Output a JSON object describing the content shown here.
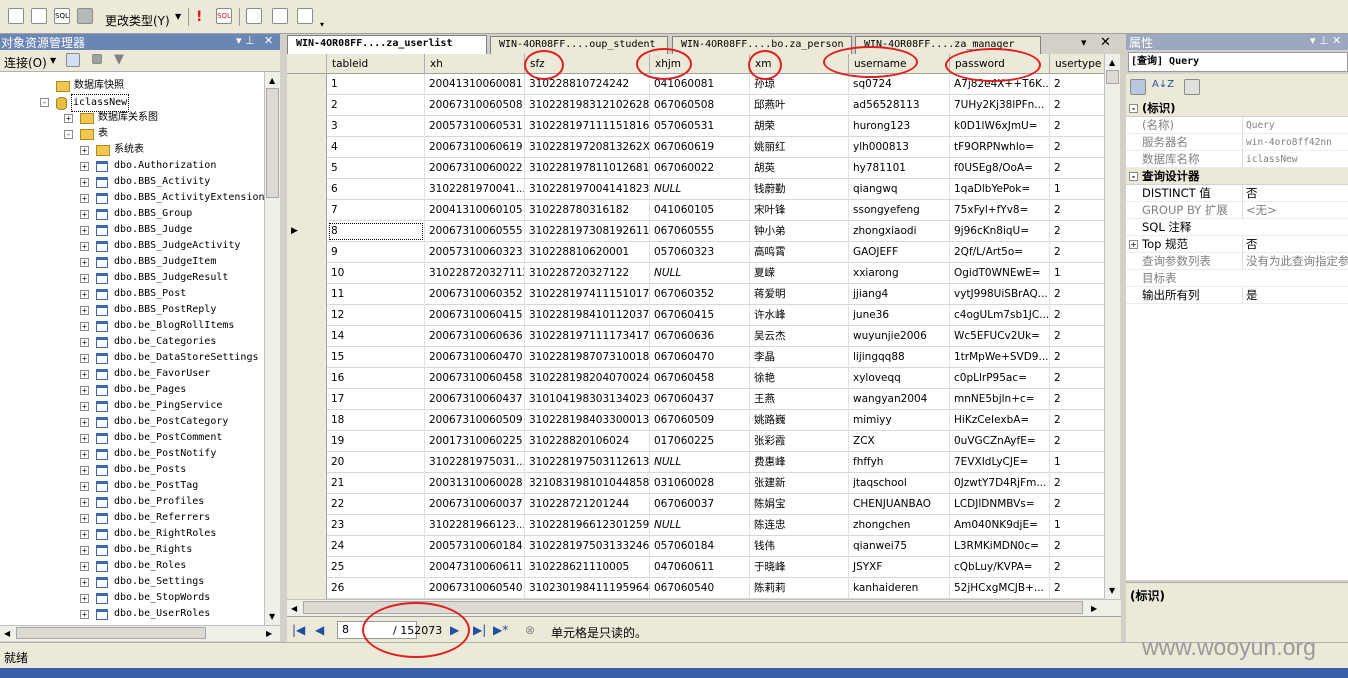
{
  "toolbar": {
    "change_type_label": "更改类型(Y)"
  },
  "object_explorer": {
    "title": "对象资源管理器",
    "connect_label": "连接(O)",
    "tree": [
      {
        "label": "数据库快照",
        "kind": "folder",
        "depth": 0,
        "toggle": ""
      },
      {
        "label": "iclassNew",
        "kind": "db",
        "depth": 0,
        "toggle": "-"
      },
      {
        "label": "数据库关系图",
        "kind": "folder",
        "depth": 1,
        "toggle": "+"
      },
      {
        "label": "表",
        "kind": "folder",
        "depth": 1,
        "toggle": "-"
      },
      {
        "label": "系统表",
        "kind": "folder",
        "depth": 2,
        "toggle": "+"
      },
      {
        "label": "dbo.Authorization",
        "kind": "table",
        "depth": 2,
        "toggle": "+"
      },
      {
        "label": "dbo.BBS_Activity",
        "kind": "table",
        "depth": 2,
        "toggle": "+"
      },
      {
        "label": "dbo.BBS_ActivityExtension",
        "kind": "table",
        "depth": 2,
        "toggle": "+"
      },
      {
        "label": "dbo.BBS_Group",
        "kind": "table",
        "depth": 2,
        "toggle": "+"
      },
      {
        "label": "dbo.BBS_Judge",
        "kind": "table",
        "depth": 2,
        "toggle": "+"
      },
      {
        "label": "dbo.BBS_JudgeActivity",
        "kind": "table",
        "depth": 2,
        "toggle": "+"
      },
      {
        "label": "dbo.BBS_JudgeItem",
        "kind": "table",
        "depth": 2,
        "toggle": "+"
      },
      {
        "label": "dbo.BBS_JudgeResult",
        "kind": "table",
        "depth": 2,
        "toggle": "+"
      },
      {
        "label": "dbo.BBS_Post",
        "kind": "table",
        "depth": 2,
        "toggle": "+"
      },
      {
        "label": "dbo.BBS_PostReply",
        "kind": "table",
        "depth": 2,
        "toggle": "+"
      },
      {
        "label": "dbo.be_BlogRollItems",
        "kind": "table",
        "depth": 2,
        "toggle": "+"
      },
      {
        "label": "dbo.be_Categories",
        "kind": "table",
        "depth": 2,
        "toggle": "+"
      },
      {
        "label": "dbo.be_DataStoreSettings",
        "kind": "table",
        "depth": 2,
        "toggle": "+"
      },
      {
        "label": "dbo.be_FavorUser",
        "kind": "table",
        "depth": 2,
        "toggle": "+"
      },
      {
        "label": "dbo.be_Pages",
        "kind": "table",
        "depth": 2,
        "toggle": "+"
      },
      {
        "label": "dbo.be_PingService",
        "kind": "table",
        "depth": 2,
        "toggle": "+"
      },
      {
        "label": "dbo.be_PostCategory",
        "kind": "table",
        "depth": 2,
        "toggle": "+"
      },
      {
        "label": "dbo.be_PostComment",
        "kind": "table",
        "depth": 2,
        "toggle": "+"
      },
      {
        "label": "dbo.be_PostNotify",
        "kind": "table",
        "depth": 2,
        "toggle": "+"
      },
      {
        "label": "dbo.be_Posts",
        "kind": "table",
        "depth": 2,
        "toggle": "+"
      },
      {
        "label": "dbo.be_PostTag",
        "kind": "table",
        "depth": 2,
        "toggle": "+"
      },
      {
        "label": "dbo.be_Profiles",
        "kind": "table",
        "depth": 2,
        "toggle": "+"
      },
      {
        "label": "dbo.be_Referrers",
        "kind": "table",
        "depth": 2,
        "toggle": "+"
      },
      {
        "label": "dbo.be_RightRoles",
        "kind": "table",
        "depth": 2,
        "toggle": "+"
      },
      {
        "label": "dbo.be_Rights",
        "kind": "table",
        "depth": 2,
        "toggle": "+"
      },
      {
        "label": "dbo.be_Roles",
        "kind": "table",
        "depth": 2,
        "toggle": "+"
      },
      {
        "label": "dbo.be_Settings",
        "kind": "table",
        "depth": 2,
        "toggle": "+"
      },
      {
        "label": "dbo.be_StopWords",
        "kind": "table",
        "depth": 2,
        "toggle": "+"
      },
      {
        "label": "dbo.be_UserRoles",
        "kind": "table",
        "depth": 2,
        "toggle": "+"
      }
    ]
  },
  "tabs": [
    {
      "label": "WIN-4OR08FF....za_userlist",
      "active": true
    },
    {
      "label": "WIN-4OR08FF....oup_student",
      "active": false
    },
    {
      "label": "WIN-4OR08FF....bo.za_person",
      "active": false
    },
    {
      "label": "WIN-4OR08FF....za_manager",
      "active": false
    }
  ],
  "grid": {
    "columns": [
      "tableid",
      "xh",
      "sfz",
      "xhjm",
      "xm",
      "username",
      "password",
      "usertype"
    ],
    "current_row": 8,
    "rows": [
      [
        "1",
        "20041310060081",
        "310228810724242",
        "041060081",
        "孙琼",
        "sq0724",
        "A7j82e4X++T6K...",
        "2"
      ],
      [
        "2",
        "20067310060508",
        "310228198312102628",
        "067060508",
        "邱燕叶",
        "ad56528113",
        "7UHy2Kj38lPFn...",
        "2"
      ],
      [
        "3",
        "20057310060531",
        "310228197111151816",
        "057060531",
        "胡荣",
        "hurong123",
        "k0D1lW6xJmU=",
        "2"
      ],
      [
        "4",
        "20067310060619",
        "31022819720813262X",
        "067060619",
        "姚丽红",
        "ylh000813",
        "tF9ORPNwhlo=",
        "2"
      ],
      [
        "5",
        "20067310060022",
        "310228197811012681",
        "067060022",
        "胡英",
        "hy781101",
        "f0USEg8/OoA=",
        "2"
      ],
      [
        "6",
        "3102281970041...",
        "310228197004141823",
        "NULL",
        "钱蔚勤",
        "qiangwq",
        "1qaDlbYePok=",
        "1"
      ],
      [
        "7",
        "20041310060105",
        "310228780316182",
        "041060105",
        "宋叶锋",
        "ssongyefeng",
        "75xFyl+fYv8=",
        "2"
      ],
      [
        "8",
        "20067310060555",
        "310228197308192611",
        "067060555",
        "钟小弟",
        "zhongxiaodi",
        "9j96cKn8iqU=",
        "2"
      ],
      [
        "9",
        "20057310060323",
        "310228810620001",
        "057060323",
        "高鸣霄",
        "GAOJEFF",
        "2Qf/L/Art5o=",
        "2"
      ],
      [
        "10",
        "3102287203271122",
        "310228720327122",
        "NULL",
        "夏嵘",
        "xxiarong",
        "OgidT0WNEwE=",
        "1"
      ],
      [
        "11",
        "20067310060352",
        "310228197411151017",
        "067060352",
        "蒋爱明",
        "jjiang4",
        "vytJ998UiSBrAQ...",
        "2"
      ],
      [
        "12",
        "20067310060415",
        "310228198410112037",
        "067060415",
        "许水峰",
        "june36",
        "c4ogULm7sb1JC...",
        "2"
      ],
      [
        "14",
        "20067310060636",
        "310228197111173417",
        "067060636",
        "吴云杰",
        "wuyunjie2006",
        "Wc5EFUCv2Uk=",
        "2"
      ],
      [
        "15",
        "20067310060470",
        "310228198707310018",
        "067060470",
        "李晶",
        "lijingqq88",
        "1trMpWe+SVD9...",
        "2"
      ],
      [
        "16",
        "20067310060458",
        "310228198204070024",
        "067060458",
        "徐艳",
        "xyloveqq",
        "c0pLlrP95ac=",
        "2"
      ],
      [
        "17",
        "20067310060437",
        "310104198303134023",
        "067060437",
        "王燕",
        "wangyan2004",
        "mnNE5bjln+c=",
        "2"
      ],
      [
        "18",
        "20067310060509",
        "310228198403300013",
        "067060509",
        "姚路巍",
        "mimiyy",
        "HiKzCeIexbA=",
        "2"
      ],
      [
        "19",
        "20017310060225",
        "310228820106024",
        "017060225",
        "张彩霞",
        "ZCX",
        "0uVGCZnAyfE=",
        "2"
      ],
      [
        "20",
        "3102281975031...",
        "310228197503112613",
        "NULL",
        "费惠峰",
        "fhffyh",
        "7EVXIdLyCJE=",
        "1"
      ],
      [
        "21",
        "20031310060028",
        "321083198101044858",
        "031060028",
        "张建新",
        "jtaqschool",
        "0JzwtY7D4RjFm...",
        "2"
      ],
      [
        "22",
        "20067310060037",
        "310228721201244",
        "067060037",
        "陈娟宝",
        "CHENJUANBAO",
        "LCDJlDNMBVs=",
        "2"
      ],
      [
        "23",
        "3102281966123...",
        "310228196612301259",
        "NULL",
        "陈连忠",
        "zhongchen",
        "Am040NK9djE=",
        "1"
      ],
      [
        "24",
        "20057310060184",
        "310228197503133246",
        "057060184",
        "钱伟",
        "qianwei75",
        "L3RMKiMDN0c=",
        "2"
      ],
      [
        "25",
        "20047310060611",
        "310228621110005",
        "047060611",
        "于晓峰",
        "JSYXF",
        "cQbLuy/KVPA=",
        "2"
      ],
      [
        "26",
        "20067310060540",
        "310230198411195964",
        "067060540",
        "陈莉莉",
        "kanhaideren",
        "52jHCxgMCJB+...",
        "2"
      ]
    ]
  },
  "nav": {
    "current": "8",
    "total": "/ 152073",
    "message": "单元格是只读的。"
  },
  "properties": {
    "title": "属性",
    "object": "[查询] Query",
    "rows": [
      {
        "kind": "cat",
        "name": "(标识)",
        "toggle": "-"
      },
      {
        "kind": "prop",
        "name": "(名称)",
        "value": "Query",
        "gray": true,
        "mono": true
      },
      {
        "kind": "prop",
        "name": "服务器名",
        "value": "win-4oro8ff42nn",
        "gray": true,
        "mono": true
      },
      {
        "kind": "prop",
        "name": "数据库名称",
        "value": "iclassNew",
        "gray": true,
        "mono": true
      },
      {
        "kind": "cat",
        "name": "查询设计器",
        "toggle": "-"
      },
      {
        "kind": "prop",
        "name": "DISTINCT 值",
        "value": "否",
        "gray": false
      },
      {
        "kind": "prop",
        "name": "GROUP BY 扩展",
        "value": "<无>",
        "gray": true
      },
      {
        "kind": "prop",
        "name": "SQL 注释",
        "value": "",
        "gray": false
      },
      {
        "kind": "prop",
        "name": "Top 规范",
        "value": "否",
        "gray": false,
        "toggle": "+"
      },
      {
        "kind": "prop",
        "name": "查询参数列表",
        "value": "没有为此查询指定参数",
        "gray": true
      },
      {
        "kind": "prop",
        "name": "目标表",
        "value": "",
        "gray": true
      },
      {
        "kind": "prop",
        "name": "输出所有列",
        "value": "是",
        "gray": false
      }
    ],
    "desc_title": "(标识)"
  },
  "status": {
    "text": "就绪"
  },
  "watermark": "www.wooyun.org"
}
